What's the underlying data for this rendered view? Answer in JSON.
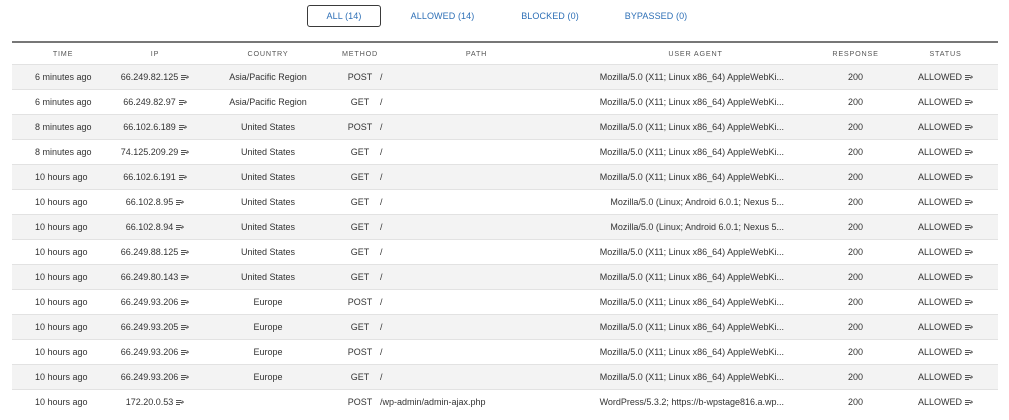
{
  "tabs": [
    {
      "label": "ALL (14)",
      "active": true
    },
    {
      "label": "ALLOWED (14)",
      "active": false
    },
    {
      "label": "BLOCKED (0)",
      "active": false
    },
    {
      "label": "BYPASSED (0)",
      "active": false
    }
  ],
  "columns": {
    "time": "TIME",
    "ip": "IP",
    "country": "COUNTRY",
    "method": "METHOD",
    "path": "PATH",
    "user_agent": "USER AGENT",
    "response": "RESPONSE",
    "status": "STATUS"
  },
  "rows": [
    {
      "time": "6 minutes ago",
      "ip": "66.249.82.125",
      "country": "Asia/Pacific Region",
      "method": "POST",
      "path": "/",
      "user_agent": "Mozilla/5.0 (X11; Linux x86_64) AppleWebKi...",
      "response": "200",
      "status": "ALLOWED"
    },
    {
      "time": "6 minutes ago",
      "ip": "66.249.82.97",
      "country": "Asia/Pacific Region",
      "method": "GET",
      "path": "/",
      "user_agent": "Mozilla/5.0 (X11; Linux x86_64) AppleWebKi...",
      "response": "200",
      "status": "ALLOWED"
    },
    {
      "time": "8 minutes ago",
      "ip": "66.102.6.189",
      "country": "United States",
      "method": "POST",
      "path": "/",
      "user_agent": "Mozilla/5.0 (X11; Linux x86_64) AppleWebKi...",
      "response": "200",
      "status": "ALLOWED"
    },
    {
      "time": "8 minutes ago",
      "ip": "74.125.209.29",
      "country": "United States",
      "method": "GET",
      "path": "/",
      "user_agent": "Mozilla/5.0 (X11; Linux x86_64) AppleWebKi...",
      "response": "200",
      "status": "ALLOWED"
    },
    {
      "time": "10 hours ago",
      "ip": "66.102.6.191",
      "country": "United States",
      "method": "GET",
      "path": "/",
      "user_agent": "Mozilla/5.0 (X11; Linux x86_64) AppleWebKi...",
      "response": "200",
      "status": "ALLOWED"
    },
    {
      "time": "10 hours ago",
      "ip": "66.102.8.95",
      "country": "United States",
      "method": "GET",
      "path": "/",
      "user_agent": "Mozilla/5.0 (Linux; Android 6.0.1; Nexus 5...",
      "response": "200",
      "status": "ALLOWED"
    },
    {
      "time": "10 hours ago",
      "ip": "66.102.8.94",
      "country": "United States",
      "method": "GET",
      "path": "/",
      "user_agent": "Mozilla/5.0 (Linux; Android 6.0.1; Nexus 5...",
      "response": "200",
      "status": "ALLOWED"
    },
    {
      "time": "10 hours ago",
      "ip": "66.249.88.125",
      "country": "United States",
      "method": "GET",
      "path": "/",
      "user_agent": "Mozilla/5.0 (X11; Linux x86_64) AppleWebKi...",
      "response": "200",
      "status": "ALLOWED"
    },
    {
      "time": "10 hours ago",
      "ip": "66.249.80.143",
      "country": "United States",
      "method": "GET",
      "path": "/",
      "user_agent": "Mozilla/5.0 (X11; Linux x86_64) AppleWebKi...",
      "response": "200",
      "status": "ALLOWED"
    },
    {
      "time": "10 hours ago",
      "ip": "66.249.93.206",
      "country": "Europe",
      "method": "POST",
      "path": "/",
      "user_agent": "Mozilla/5.0 (X11; Linux x86_64) AppleWebKi...",
      "response": "200",
      "status": "ALLOWED"
    },
    {
      "time": "10 hours ago",
      "ip": "66.249.93.205",
      "country": "Europe",
      "method": "GET",
      "path": "/",
      "user_agent": "Mozilla/5.0 (X11; Linux x86_64) AppleWebKi...",
      "response": "200",
      "status": "ALLOWED"
    },
    {
      "time": "10 hours ago",
      "ip": "66.249.93.206",
      "country": "Europe",
      "method": "POST",
      "path": "/",
      "user_agent": "Mozilla/5.0 (X11; Linux x86_64) AppleWebKi...",
      "response": "200",
      "status": "ALLOWED"
    },
    {
      "time": "10 hours ago",
      "ip": "66.249.93.206",
      "country": "Europe",
      "method": "GET",
      "path": "/",
      "user_agent": "Mozilla/5.0 (X11; Linux x86_64) AppleWebKi...",
      "response": "200",
      "status": "ALLOWED"
    },
    {
      "time": "10 hours ago",
      "ip": "172.20.0.53",
      "country": "",
      "method": "POST",
      "path": "/wp-admin/admin-ajax.php",
      "user_agent": "WordPress/5.3.2; https://b-wpstage816.a.wp...",
      "response": "200",
      "status": "ALLOWED"
    }
  ],
  "icons": {
    "filter": "filter-lines-icon"
  }
}
